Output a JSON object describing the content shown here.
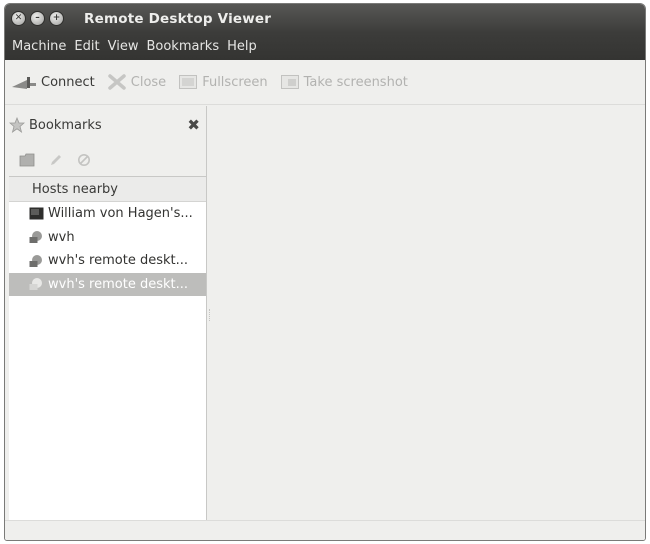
{
  "window": {
    "title": "Remote Desktop Viewer"
  },
  "menubar": {
    "items": [
      "Machine",
      "Edit",
      "View",
      "Bookmarks",
      "Help"
    ]
  },
  "toolbar": {
    "connect_label": "Connect",
    "close_label": "Close",
    "fullscreen_label": "Fullscreen",
    "screenshot_label": "Take screenshot"
  },
  "sidebar": {
    "title": "Bookmarks",
    "list_header": "Hosts nearby",
    "hosts": [
      {
        "label": "William von Hagen's...",
        "icon": "monitor-icon"
      },
      {
        "label": "wvh",
        "icon": "network-host-icon"
      },
      {
        "label": "wvh's remote deskt...",
        "icon": "network-host-icon"
      },
      {
        "label": "wvh's remote deskt...",
        "icon": "network-host-icon",
        "selected": true
      }
    ]
  },
  "colors": {
    "titlebar": "#3c3c3a",
    "window_bg": "#efefed",
    "selection": "#bdbdbb"
  }
}
